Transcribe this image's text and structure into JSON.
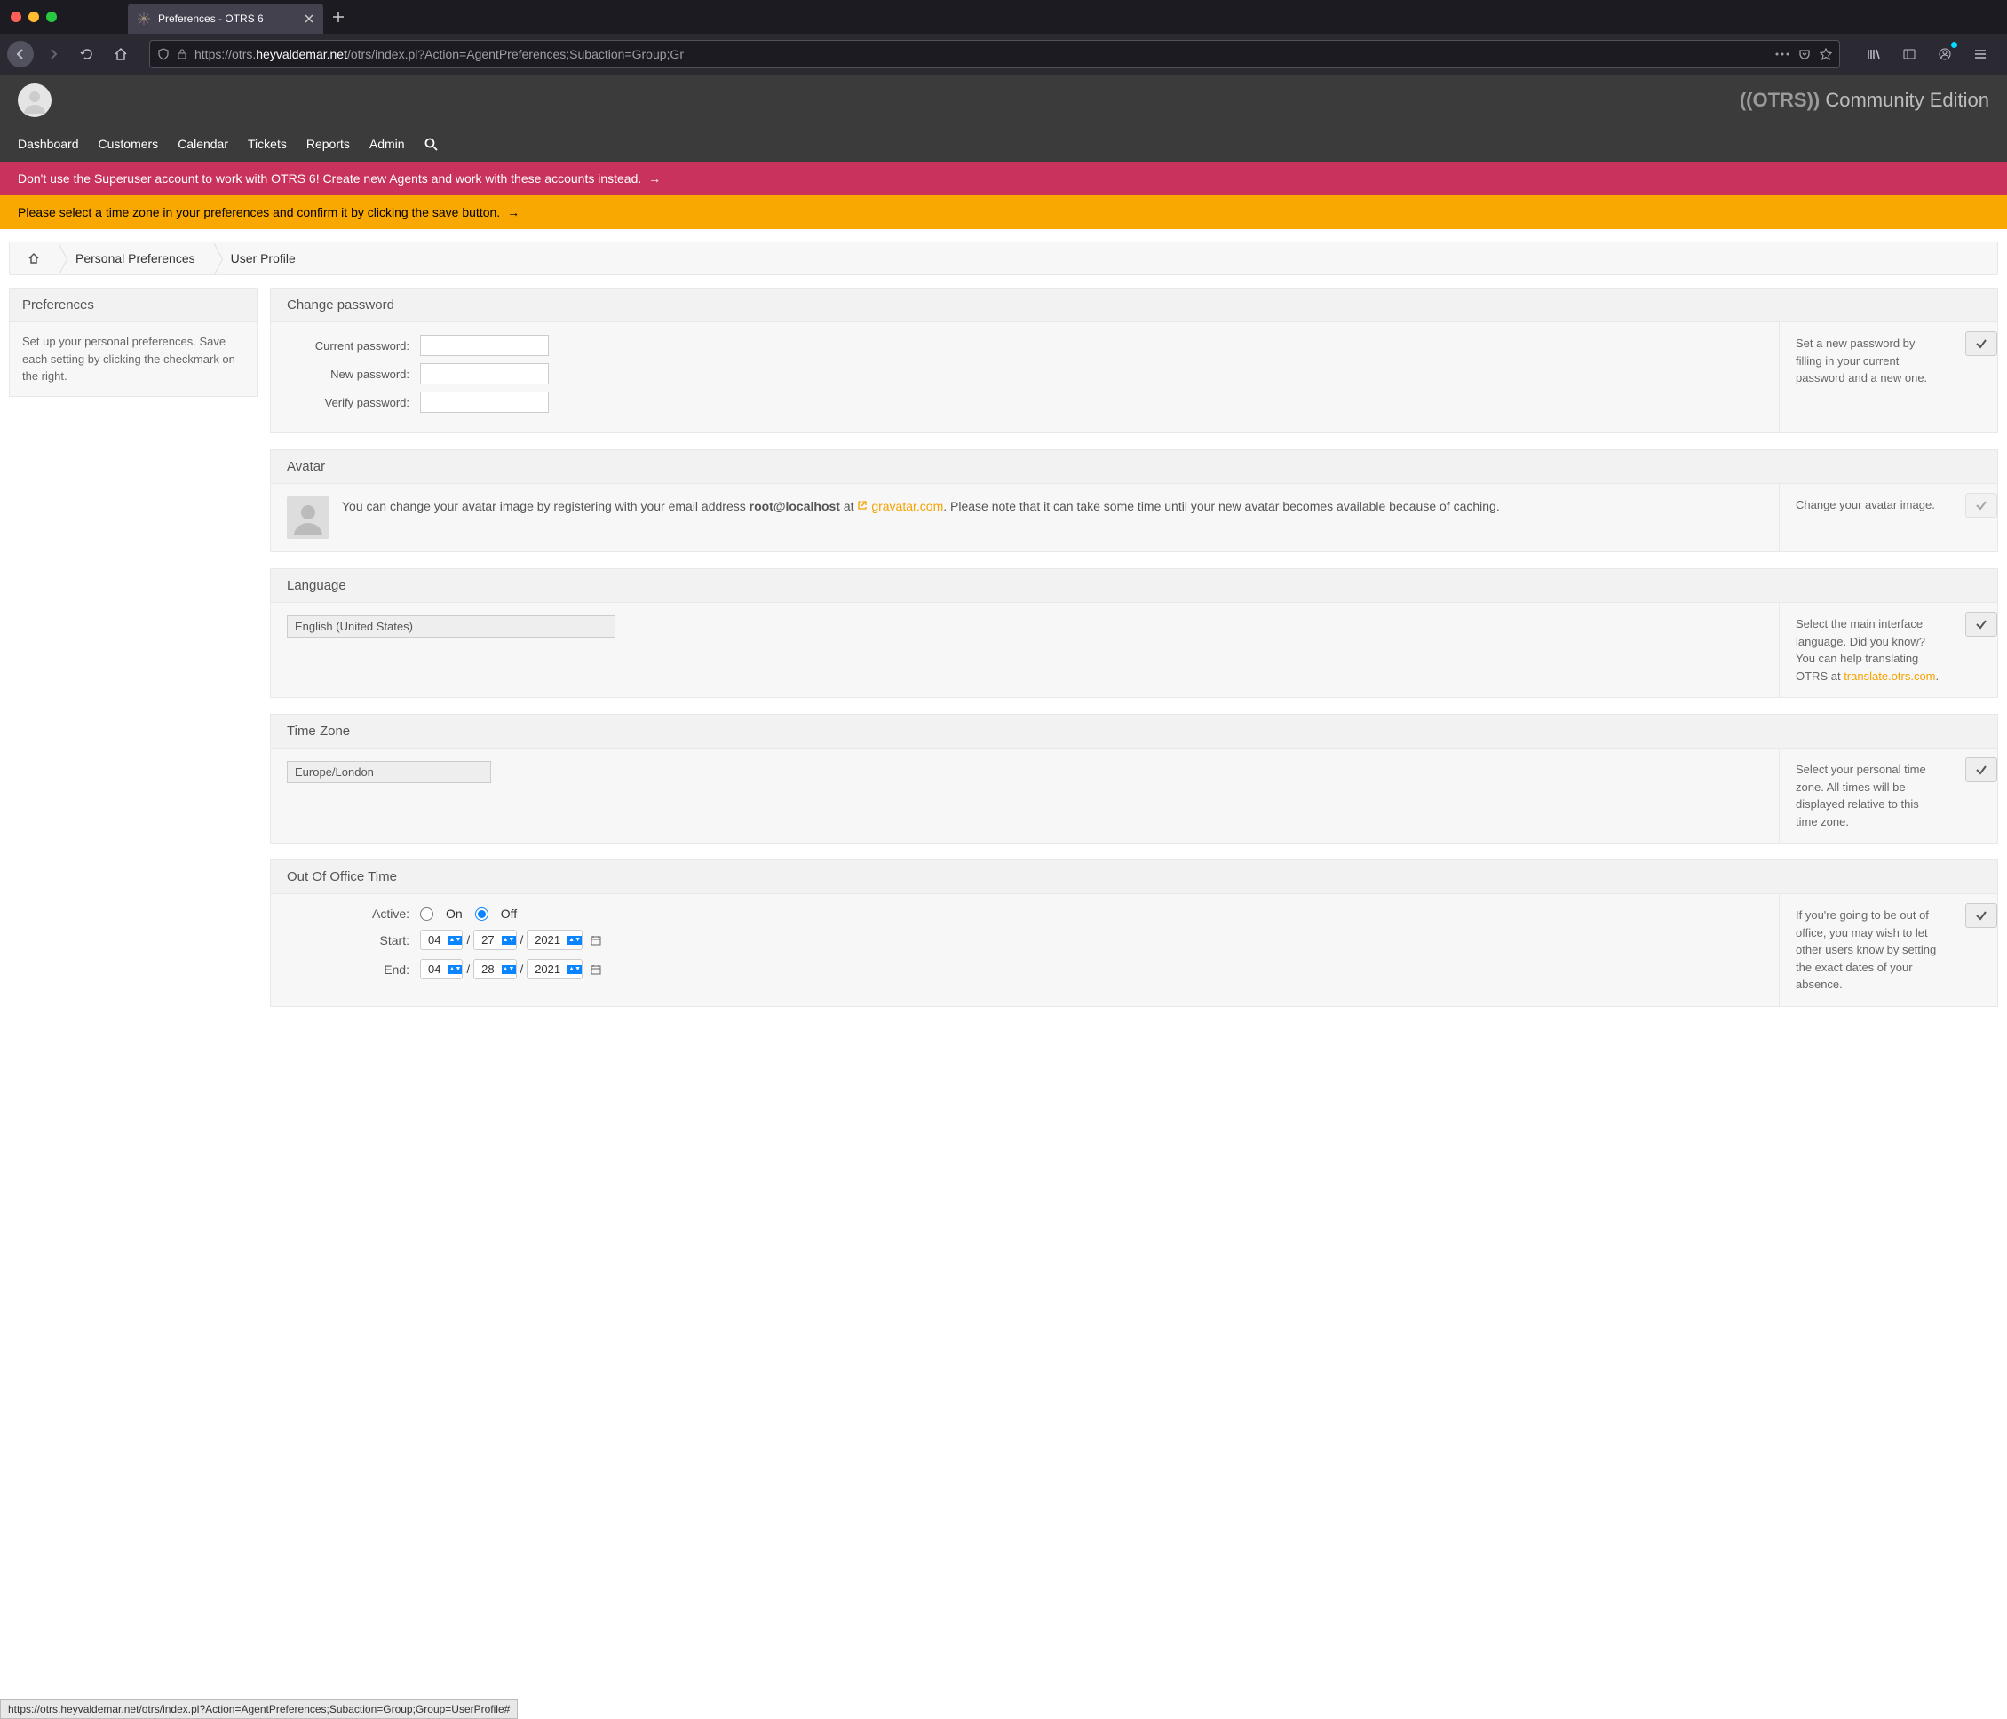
{
  "browser": {
    "tab_title": "Preferences - OTRS 6",
    "url_prefix": "https://otrs.",
    "url_domain": "heyvaldemar.net",
    "url_path": "/otrs/index.pl?Action=AgentPreferences;Subaction=Group;Gr"
  },
  "app_header": {
    "brand": "((OTRS))",
    "edition": "Community Edition"
  },
  "nav": {
    "items": [
      "Dashboard",
      "Customers",
      "Calendar",
      "Tickets",
      "Reports",
      "Admin"
    ]
  },
  "banners": {
    "danger": "Don't use the Superuser account to work with OTRS 6! Create new Agents and work with these accounts instead.",
    "warning": "Please select a time zone in your preferences and confirm it by clicking the save button."
  },
  "breadcrumb": {
    "items": [
      "Personal Preferences",
      "User Profile"
    ]
  },
  "sidebar": {
    "title": "Preferences",
    "body": "Set up your personal preferences. Save each setting by clicking the checkmark on the right."
  },
  "panels": {
    "change_password": {
      "title": "Change password",
      "fields": {
        "current": "Current password:",
        "new": "New password:",
        "verify": "Verify password:"
      },
      "help": "Set a new password by filling in your current password and a new one."
    },
    "avatar": {
      "title": "Avatar",
      "text_before": "You can change your avatar image by registering with your email address ",
      "email": "root@localhost",
      "text_at": " at ",
      "link": "gravatar.com",
      "text_after": ". Please note that it can take some time until your new avatar becomes available because of caching.",
      "help": "Change your avatar image."
    },
    "language": {
      "title": "Language",
      "value": "English (United States)",
      "help_before": "Select the main interface language. Did you know? You can help translating OTRS at ",
      "help_link": "translate.otrs.com",
      "help_after": "."
    },
    "timezone": {
      "title": "Time Zone",
      "value": "Europe/London",
      "help": "Select your personal time zone. All times will be displayed relative to this time zone."
    },
    "ooo": {
      "title": "Out Of Office Time",
      "active_label": "Active:",
      "on_label": "On",
      "off_label": "Off",
      "active_value": "Off",
      "start_label": "Start:",
      "end_label": "End:",
      "start": {
        "month": "04",
        "day": "27",
        "year": "2021"
      },
      "end": {
        "month": "04",
        "day": "28",
        "year": "2021"
      },
      "help": "If you're going to be out of office, you may wish to let other users know by setting the exact dates of your absence."
    }
  },
  "status_bar": "https://otrs.heyvaldemar.net/otrs/index.pl?Action=AgentPreferences;Subaction=Group;Group=UserProfile#"
}
